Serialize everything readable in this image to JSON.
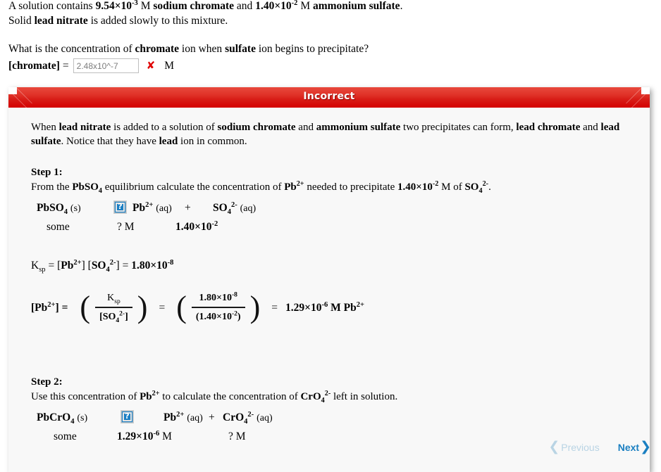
{
  "question": {
    "line1_pre": "A solution contains ",
    "conc1": "9.54×10",
    "conc1_exp": "-3",
    "line1_mid": " M ",
    "species1": "sodium chromate",
    "line1_and": " and ",
    "conc2": "1.40×10",
    "conc2_exp": "-2",
    "line1_mid2": " M ",
    "species2": "ammonium sulfate",
    "line1_end": ".",
    "line2_pre": "Solid ",
    "species3": "lead nitrate",
    "line2_end": " is added slowly to this mixture.",
    "prompt_pre": "What is the concentration of ",
    "prompt_ion1": "chromate",
    "prompt_mid": " ion when ",
    "prompt_ion2": "sulfate",
    "prompt_end": " ion begins to precipitate?",
    "answer_label": "[chromate]",
    "equals": "=",
    "answer_value": "2.48x10^-7",
    "answer_placeholder": "",
    "mark": "✘",
    "unit": "M"
  },
  "feedback": {
    "banner_title": "Incorrect",
    "banner_color": "#d81e18",
    "intro": {
      "t1": "When ",
      "b1": "lead nitrate",
      "t2": " is added to a solution of ",
      "b2": "sodium chromate",
      "t3": " and ",
      "b3": "ammonium sulfate",
      "t4": " two precipitates can form, ",
      "b4": "lead chromate",
      "t5": " and ",
      "b5": "lead sulfate",
      "t6": ". Notice that they have ",
      "b6": "lead",
      "t7": " ion in common."
    },
    "step1": {
      "heading": "Step 1:",
      "text_pre": "From the ",
      "text_formula": "PbSO",
      "text_formula_sub": "4",
      "text_mid": " equilibrium calculate the concentration of ",
      "text_ion": "Pb",
      "text_ion_sup": "2+",
      "text_mid2": " needed to precipitate ",
      "text_conc": "1.40×10",
      "text_conc_exp": "-2",
      "text_mid3": " M of ",
      "text_ion2": "SO",
      "text_ion2_sub": "4",
      "text_ion2_sup": "2-",
      "text_end": ".",
      "reaction": {
        "reactant": "PbSO",
        "reactant_sub": "4",
        "reactant_phase": "(s)",
        "arrow_icon": "broken-image-icon",
        "product1": "Pb",
        "product1_sup": "2+",
        "product1_phase": "(aq)",
        "plus": "+",
        "product2": "SO",
        "product2_sub": "4",
        "product2_sup": "2-",
        "product2_phase": "(aq)",
        "reactant_amount": "some",
        "product1_amount": "? M",
        "product2_amount": "1.40×10",
        "product2_amount_exp": "-2"
      },
      "ksp": {
        "symbol": "K",
        "symbol_sub": "sp",
        "eq1": " = [",
        "ion1": "Pb",
        "ion1_sup": "2+",
        "mid": "] [",
        "ion2": "SO",
        "ion2_sub": "4",
        "ion2_sup": "2-",
        "eq2": "] = ",
        "value": "1.80×10",
        "value_exp": "-8"
      },
      "solve": {
        "lhs": "[Pb",
        "lhs_sup": "2+",
        "lhs_end": "] =",
        "frac1_num": "K",
        "frac1_num_sub": "sp",
        "frac1_den": "[SO",
        "frac1_den_sub": "4",
        "frac1_den_sup": "2-",
        "frac1_den_end": "]",
        "op1": "=",
        "frac2_num": "1.80×10",
        "frac2_num_exp": "-8",
        "frac2_den": "(1.40×10",
        "frac2_den_exp": "-2",
        "frac2_den_end": ")",
        "op2": "=",
        "result": "1.29×10",
        "result_exp": "-6",
        "result_unit": " M Pb",
        "result_unit_sup": "2+"
      }
    },
    "step2": {
      "heading": "Step 2:",
      "text_pre": "Use this concentration of ",
      "text_ion": "Pb",
      "text_ion_sup": "2+",
      "text_mid": " to calculate the concentration of ",
      "text_ion2": "CrO",
      "text_ion2_sub": "4",
      "text_ion2_sup": "2-",
      "text_end": " left in solution.",
      "reaction": {
        "reactant": "PbCrO",
        "reactant_sub": "4",
        "reactant_phase": "(s)",
        "arrow_icon": "broken-image-icon",
        "product1": "Pb",
        "product1_sup": "2+",
        "product1_phase": "(aq)",
        "plus": "+",
        "product2": "CrO",
        "product2_sub": "4",
        "product2_sup": "2-",
        "product2_phase": "(aq)",
        "reactant_amount": "some",
        "product1_amount": "1.29×10",
        "product1_amount_exp": "-6",
        "product1_amount_unit": " M",
        "product2_amount": "? M"
      }
    }
  },
  "nav": {
    "previous_label": "Previous",
    "previous_chevron": "❮",
    "next_label": "Next",
    "next_chevron": "❯",
    "previous_color": "#b9d4e4",
    "next_color": "#1a7fc1"
  }
}
